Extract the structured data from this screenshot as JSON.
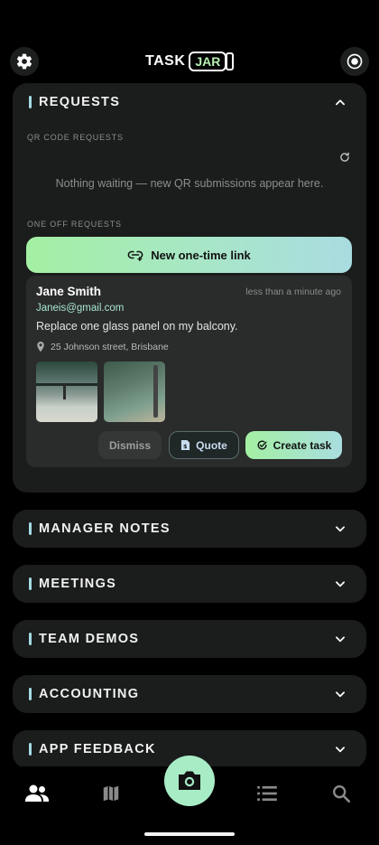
{
  "app": {
    "logo_task": "TASK",
    "logo_jar": "JAR",
    "settings_icon": "gear-icon",
    "record_icon": "record-icon"
  },
  "requests": {
    "title": "REQUESTS",
    "qr_label": "QR CODE REQUESTS",
    "qr_empty": "Nothing waiting — new QR submissions appear here.",
    "oneoff_label": "ONE OFF REQUESTS",
    "new_link_label": "New one-time link",
    "items": [
      {
        "name": "Jane Smith",
        "time": "less than a minute ago",
        "email": "Janeis@gmail.com",
        "description": "Replace one glass panel on my balcony.",
        "address": "25 Johnson street, Brisbane",
        "dismiss_label": "Dismiss",
        "quote_label": "Quote",
        "create_label": "Create task"
      }
    ]
  },
  "sections": [
    {
      "title": "MANAGER NOTES"
    },
    {
      "title": "MEETINGS"
    },
    {
      "title": "TEAM DEMOS"
    },
    {
      "title": "ACCOUNTING"
    },
    {
      "title": "APP FEEDBACK"
    }
  ],
  "nav": {
    "items": [
      "team-icon",
      "map-icon",
      "camera-icon",
      "list-icon",
      "search-icon"
    ]
  },
  "colors": {
    "accent_green": "#a3f0a3",
    "accent_teal": "#a9dce0",
    "card_bg": "#1b1c1c",
    "section_bar": "#a5dbe4"
  }
}
